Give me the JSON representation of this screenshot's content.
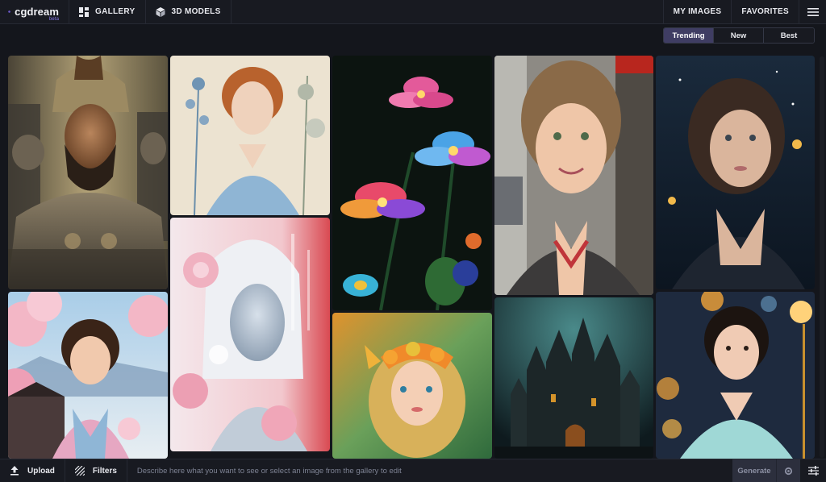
{
  "app": {
    "brand": "cgdream",
    "badge": "beta"
  },
  "nav": {
    "gallery": "GALLERY",
    "models": "3D MODELS",
    "my_images": "MY IMAGES",
    "favorites": "FAVORITES"
  },
  "sort": {
    "trending": "Trending",
    "new": "New",
    "best": "Best",
    "active": "Trending"
  },
  "gallery": {
    "images": [
      {
        "subject": "spartan-warrior-portrait"
      },
      {
        "subject": "botanical-redhead-portrait"
      },
      {
        "subject": "cyber-ice-woman-portrait"
      },
      {
        "subject": "glowing-flowers"
      },
      {
        "subject": "fairy-girl-portrait"
      },
      {
        "subject": "smiling-girl-portrait"
      },
      {
        "subject": "dark-castle"
      },
      {
        "subject": "night-woman-portrait"
      },
      {
        "subject": "bokeh-girl-portrait"
      },
      {
        "subject": "cherry-blossom-girl-portrait"
      }
    ]
  },
  "bottombar": {
    "upload": "Upload",
    "filters": "Filters",
    "prompt_placeholder": "Describe here what you want to see or select an image from the gallery to edit",
    "prompt_value": "",
    "generate": "Generate"
  },
  "colors": {
    "background": "#14161c",
    "bar": "#181a21",
    "accent": "#3f3d63",
    "brand": "#7b61ff"
  }
}
